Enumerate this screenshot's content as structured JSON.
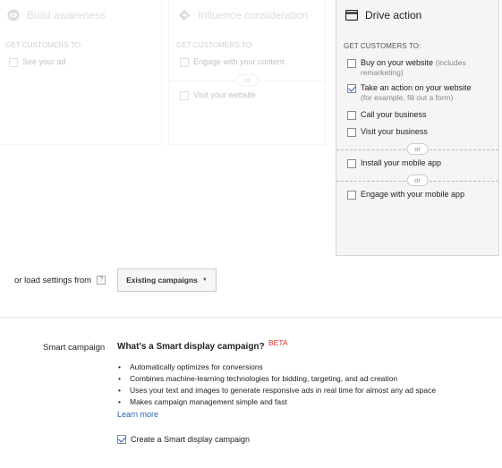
{
  "goals": [
    {
      "title": "Build awareness",
      "icon": "eye-icon",
      "subtitle": "GET CUSTOMERS TO:",
      "options": [
        {
          "label": "See your ad",
          "checked": false
        }
      ]
    },
    {
      "title": "Influence consideration",
      "icon": "diamond-arrow-icon",
      "subtitle": "GET CUSTOMERS TO:",
      "options": [
        {
          "label": "Engage with your content",
          "checked": false
        },
        {
          "label": "Visit your website",
          "checked": false
        }
      ],
      "or": "or"
    },
    {
      "title": "Drive action",
      "icon": "card-icon",
      "subtitle": "GET CUSTOMERS TO:",
      "options": [
        {
          "label": "Buy on your website",
          "hint": "(includes remarketing)",
          "checked": false
        },
        {
          "label": "Take an action on your website",
          "hint": "(for example, fill out a form)",
          "checked": true
        },
        {
          "label": "Call your business",
          "checked": false
        },
        {
          "label": "Visit your business",
          "checked": false
        },
        {
          "label": "Install your mobile app",
          "checked": false
        },
        {
          "label": "Engage with your mobile app",
          "checked": false
        }
      ],
      "or": "or"
    }
  ],
  "load_settings": {
    "label": "or load settings from",
    "help": "?",
    "button": "Existing campaigns"
  },
  "smart": {
    "label": "Smart campaign",
    "heading": "What's a Smart display campaign?",
    "badge": "BETA",
    "bullets": [
      "Automatically optimizes for conversions",
      "Combines machine-learning technologies for bidding, targeting, and ad creation",
      "Uses your text and images to generate responsive ads in real time for almost any ad space",
      "Makes campaign management simple and fast"
    ],
    "learn_more": "Learn more",
    "checkbox_label": "Create a Smart display campaign",
    "checked": true
  },
  "colors": {
    "accent": "#2a5fb7",
    "beta": "#d93025"
  }
}
